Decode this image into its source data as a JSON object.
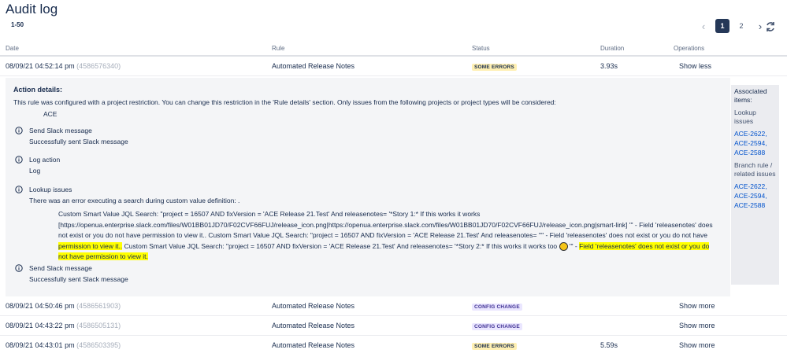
{
  "page": {
    "title": "Audit log",
    "range": "1-50"
  },
  "pagination": {
    "prev_icon": "chevron-left-icon",
    "pages": [
      "1",
      "2"
    ],
    "current": "1",
    "next_icon": "chevron-right-icon",
    "refresh_icon": "refresh-icon"
  },
  "table": {
    "headers": [
      "Date",
      "Rule",
      "Status",
      "Duration",
      "Operations"
    ],
    "rows": [
      {
        "date": "08/09/21 04:52:14 pm",
        "id": "(4586576340)",
        "rule": "Automated Release Notes",
        "status": "SOME ERRORS",
        "duration": "3.93s",
        "op": "Show less"
      },
      {
        "date": "08/09/21 04:50:46 pm",
        "id": "(4586561903)",
        "rule": "Automated Release Notes",
        "status": "CONFIG CHANGE",
        "duration": "",
        "op": "Show more"
      },
      {
        "date": "08/09/21 04:43:22 pm",
        "id": "(4586505131)",
        "rule": "Automated Release Notes",
        "status": "CONFIG CHANGE",
        "duration": "",
        "op": "Show more"
      },
      {
        "date": "08/09/21 04:43:01 pm",
        "id": "(4586503395)",
        "rule": "Automated Release Notes",
        "status": "SOME ERRORS",
        "duration": "5.59s",
        "op": "Show more"
      }
    ]
  },
  "status_colors": {
    "SOME ERRORS": "#fff0b3",
    "CONFIG CHANGE": "#eae6ff"
  },
  "details": {
    "title": "Action details:",
    "description": "This rule was configured with a project restriction. You can change this restriction in the 'Rule details' section. Only issues from the following projects or project types will be considered:",
    "project": "ACE",
    "steps": [
      {
        "label": "Send Slack message",
        "sub": "Successfully sent Slack message",
        "icon": "info-icon"
      },
      {
        "label": "Log action",
        "sub": "Log",
        "icon": "info-icon"
      },
      {
        "label": "Lookup issues",
        "sub": "There was an error executing a search during custom value definition: .",
        "icon": "info-icon"
      },
      {
        "label": "Send Slack message",
        "sub": "Successfully sent Slack message",
        "icon": "info-icon"
      }
    ],
    "lookup_message": {
      "part1": "Custom Smart Value JQL Search: \"project = 16507 AND fixVersion = 'ACE Release 21.Test' And releasenotes= '*Story 1:* If this works it works [https://openua.enterprise.slack.com/files/W01BB01JD70/F02CVF66FUJ/release_icon.png|https://openua.enterprise.slack.com/files/W01BB01JD70/F02CVF66FUJ/release_icon.png|smart-link] '\" - Field 'releasenotes' does not exist or you do not have permission to view it.. Custom Smart Value JQL Search: \"project = 16507 AND fixVersion = 'ACE Release 21.Test' And releasenotes= ''\" - Field 'releasenotes' does not exist or you do not have ",
      "hl1": "permission to view it..",
      "part2": " Custom Smart Value JQL Search: \"project = 16507 AND fixVersion = 'ACE Release 21.Test' And releasenotes= '*Story 2:* If this works it works too ",
      "emoji": "smiley-emoji-icon",
      "part3": " '\" - ",
      "hl2": "Field 'releasenotes' does not exist or you do not have permission to view it."
    }
  },
  "associated": {
    "title_line1": "Associated",
    "title_line2": "items:",
    "lookup_line1": "Lookup",
    "lookup_line2": "issues",
    "lookup_links": [
      "ACE-2622,",
      "ACE-2594,",
      "ACE-2588"
    ],
    "branch_line1": "Branch rule /",
    "branch_line2": "related issues",
    "branch_links": [
      "ACE-2622,",
      "ACE-2594,",
      "ACE-2588"
    ]
  }
}
